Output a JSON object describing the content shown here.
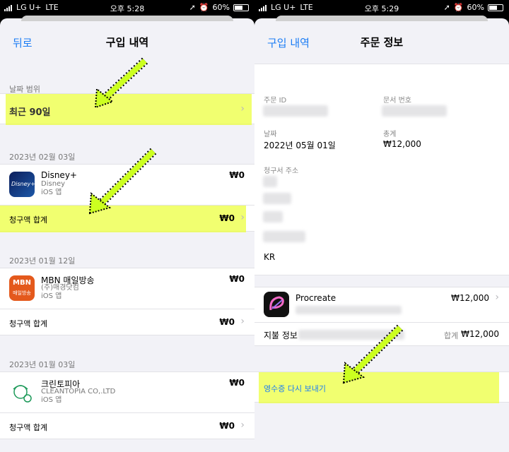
{
  "status_left": {
    "carrier": "LG U+",
    "network": "LTE",
    "time": "오후 5:28",
    "battery": "60%"
  },
  "status_right": {
    "carrier": "LG U+",
    "network": "LTE",
    "time": "오후 5:29",
    "battery": "60%"
  },
  "left": {
    "back_label": "뒤로",
    "title": "구입 내역",
    "date_range_header": "날짜 범위",
    "date_range_value": "최근 90일",
    "groups": [
      {
        "date": "2023년 02월 03일",
        "app_name": "Disney+",
        "publisher": "Disney",
        "kind": "iOS 앱",
        "price": "₩0",
        "total_label": "청구액 합계",
        "total_value": "₩0",
        "icon_text": "Disney+"
      },
      {
        "date": "2023년 01월 12일",
        "app_name": "MBN 매일방송",
        "publisher": "(주)매경닷컴",
        "kind": "iOS 앱",
        "price": "₩0",
        "total_label": "청구액 합계",
        "total_value": "₩0",
        "icon_text_top": "MBN",
        "icon_text_bottom": "매일방송"
      },
      {
        "date": "2023년 01월 03일",
        "app_name": "크린토피아",
        "publisher": "CLEANTOPIA CO,.LTD",
        "kind": "iOS 앱",
        "price": "₩0",
        "total_label": "청구액 합계",
        "total_value": "₩0"
      }
    ]
  },
  "right": {
    "back_label": "구입 내역",
    "title": "주문 정보",
    "order_id_label": "주문 ID",
    "document_no_label": "문서 번호",
    "date_label": "날짜",
    "date_value": "2022년 05월 01일",
    "total_label": "총계",
    "total_value": "₩12,000",
    "billing_address_label": "청구서 주소",
    "billing_country": "KR",
    "item_name": "Procreate",
    "item_price": "₩12,000",
    "payment_label": "지불 정보",
    "sum_label": "합계",
    "sum_value": "₩12,000",
    "resend_receipt": "영수증 다시 보내기"
  },
  "colors": {
    "accent": "#1a7cf5",
    "highlight": "#ecff40",
    "background": "#f2f2f7"
  }
}
